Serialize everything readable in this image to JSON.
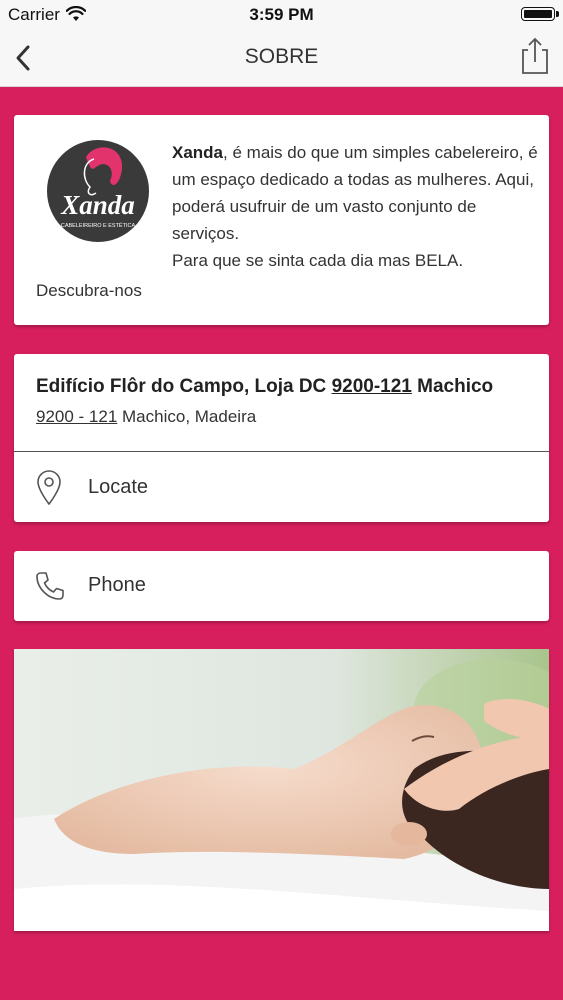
{
  "status_bar": {
    "carrier": "Carrier",
    "time": "3:59 PM"
  },
  "nav": {
    "title": "SOBRE"
  },
  "about": {
    "logo_text": "Xanda",
    "logo_subtitle": "CABELEIREIRO E ESTÉTICA",
    "brand": "Xanda",
    "text_rest": ", é mais do que um simples cabelereiro, é um espaço dedicado a todas as mulheres. Aqui, poderá usufruir de um vasto conjunto de serviços.",
    "text_line2": "Para que se sinta cada dia mas BELA.",
    "discover": "Descubra-nos"
  },
  "address": {
    "line1_prefix": "Edifício Flôr do Campo, Loja DC ",
    "line1_postal": "9200-121",
    "line1_suffix": " Machico",
    "line2_postal": "9200 - 121",
    "line2_suffix": " Machico, Madeira",
    "locate_label": "Locate"
  },
  "phone": {
    "label": "Phone"
  },
  "colors": {
    "background": "#d81f5e",
    "accent": "#e2336d",
    "logo_dark": "#3a3a3a"
  }
}
